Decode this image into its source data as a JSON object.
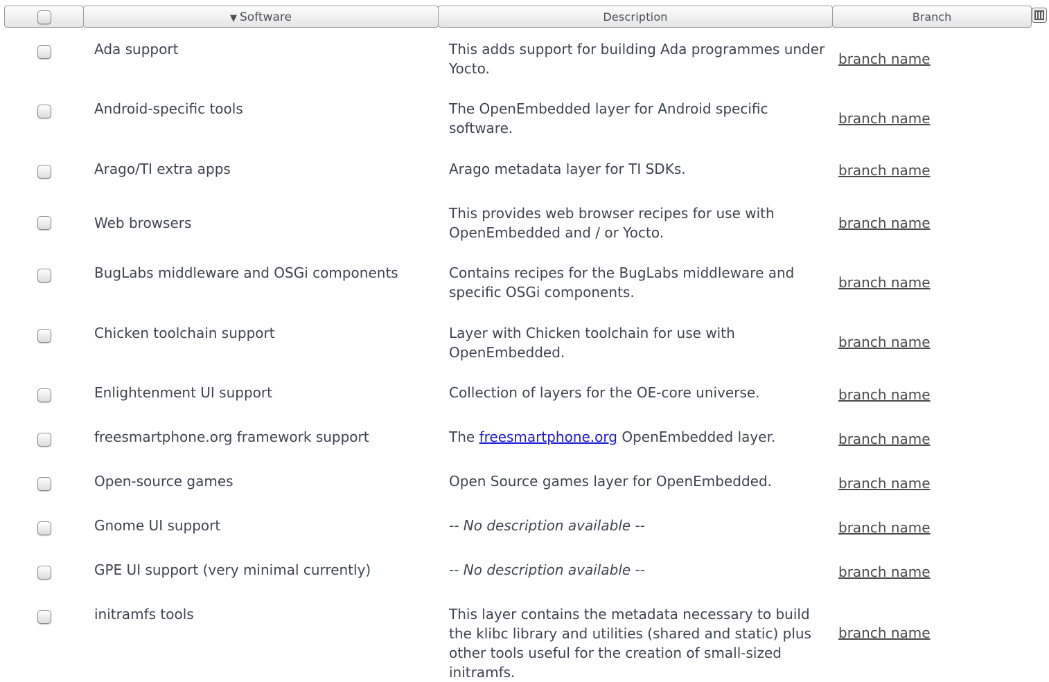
{
  "header": {
    "software_label": "Software",
    "description_label": "Description",
    "branch_label": "Branch",
    "sort_arrow": "▼"
  },
  "rows": [
    {
      "software": "Ada support",
      "description": "This adds support for building Ada programmes under Yocto.",
      "branch": "branch name"
    },
    {
      "software": "Android-specific tools",
      "description": "The OpenEmbedded layer for Android specific software.",
      "branch": "branch name"
    },
    {
      "software": "Arago/TI extra apps",
      "description": "Arago metadata layer for TI SDKs.",
      "branch": "branch name"
    },
    {
      "software": "Web browsers",
      "description": "This provides web browser recipes for use with OpenEmbedded and / or Yocto.",
      "branch": "branch name"
    },
    {
      "software": "BugLabs middleware and OSGi components",
      "description": "Contains recipes for the BugLabs middleware and specific OSGi components.",
      "branch": "branch name"
    },
    {
      "software": "Chicken toolchain support",
      "description": "Layer with Chicken toolchain for use with OpenEmbedded.",
      "branch": "branch name"
    },
    {
      "software": "Enlightenment UI support",
      "description": "Collection of layers for the OE-core universe.",
      "branch": "branch name"
    },
    {
      "software": "freesmartphone.org framework support",
      "description_prefix": "The ",
      "description_link": "freesmartphone.org",
      "description_suffix": " OpenEmbedded layer.",
      "branch": "branch name"
    },
    {
      "software": "Open-source games",
      "description": "Open Source games layer for OpenEmbedded.",
      "branch": "branch name"
    },
    {
      "software": "Gnome UI support",
      "description": "-- No description available --",
      "branch": "branch name"
    },
    {
      "software": "GPE UI support (very minimal currently)",
      "description": "-- No description available --",
      "branch": "branch name"
    },
    {
      "software": "initramfs tools",
      "description": "This layer contains the metadata necessary to build the klibc library and utilities (shared and static) plus other tools useful for the creation of small-sized initramfs.",
      "branch": "branch name"
    }
  ]
}
